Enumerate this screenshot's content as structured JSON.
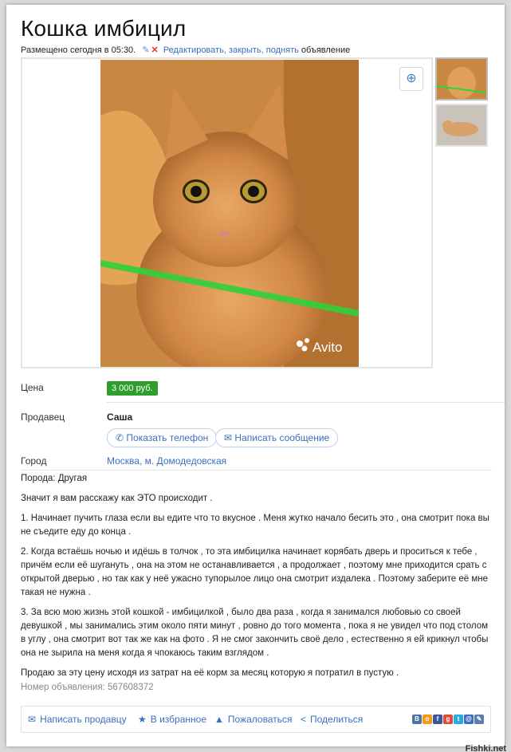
{
  "title": "Кошка имбицил",
  "meta": {
    "posted": "Размещено сегодня в 05:30.",
    "edit_link": "Редактировать, закрыть, поднять",
    "suffix": "объявление"
  },
  "photo": {
    "watermark": "Avito"
  },
  "price": {
    "label": "Цена",
    "value": "3 000 руб."
  },
  "seller": {
    "label": "Продавец",
    "name": "Саша",
    "phone_btn": "Показать телефон",
    "message_btn": "Написать сообщение"
  },
  "city": {
    "label": "Город",
    "value": "Москва, м. Домодедовская"
  },
  "description": [
    "Порода: Другая",
    "Значит я вам расскажу как ЭТО происходит .",
    "1. Начинает пучить глаза если вы едите что то вкусное . Меня жутко начало бесить это , она смотрит пока вы не съедите еду до конца .",
    "2. Когда встаёшь ночью и идёшь в толчок , то эта имбицилка начинает корябать дверь и проситься к тебе , причём если её шугануть , она на этом не останавливается , а продолжает , поэтому мне приходится срать с открытой дверью , но так как у неё ужасно тупорылое лицо она смотрит издалека . Поэтому заберите её мне такая не нужна .",
    "3. За всю мою жизнь этой кошкой - имбицилкой , было два раза , когда я занимался любовью со своей девушкой , мы занимались этим около пяти минут , ровно до того момента , пока я не увидел что под столом в углу , она смотрит вот так же как на фото . Я не смог закончить своё дело , естественно я ей крикнул чтобы она не зырила на меня когда я чпокаюсь таким взглядом .",
    "Продаю за эту цену исходя из затрат на её корм за месяц которую я потратил в пустую ."
  ],
  "ad_number": "Номер объявления: 567608372",
  "footer": {
    "write_seller": "Написать продавцу",
    "favorite": "В избранное",
    "complain": "Пожаловаться",
    "share": "Поделиться"
  },
  "site_watermark": "Fishki.net"
}
